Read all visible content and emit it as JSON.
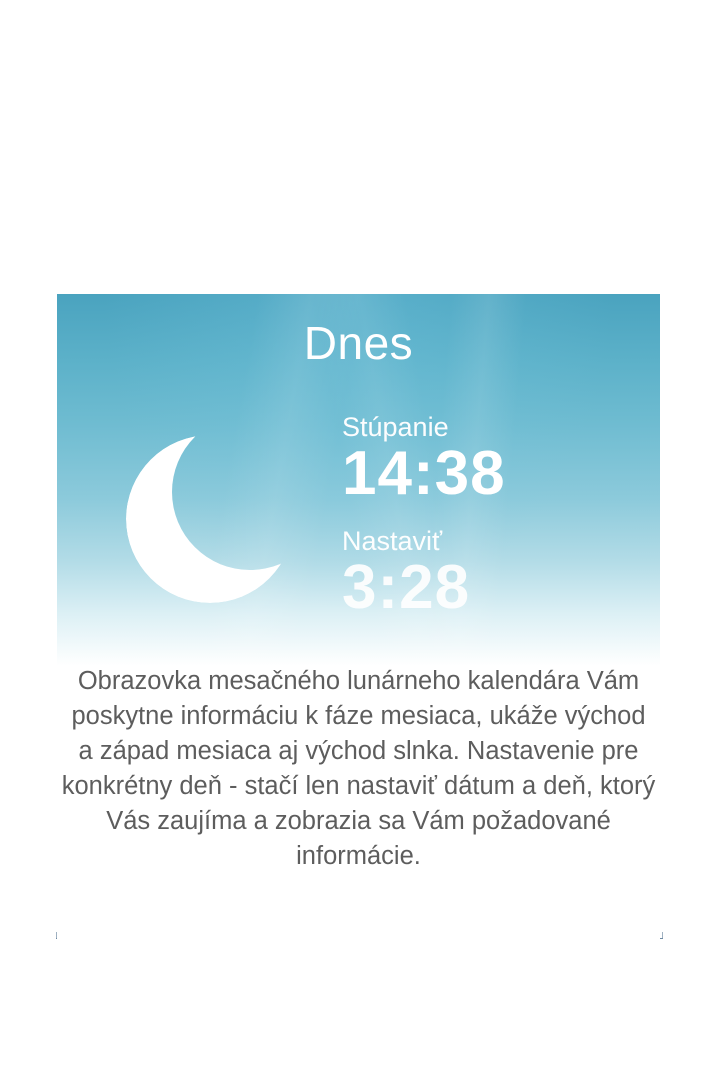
{
  "card": {
    "title": "Dnes",
    "moonrise": {
      "label": "Stúpanie",
      "time": "14:38"
    },
    "moonset": {
      "label": "Nastaviť",
      "time": "3:28"
    },
    "moon_icon": "crescent-moon-icon"
  },
  "description": "Obrazovka mesačného lunárneho kalendára Vám poskytne informáciu k fáze mesiaca, ukáže východ a západ mesiaca aj východ slnka. Nastavenie pre konkrétny deň - stačí len nastaviť dátum a deň, ktorý Vás zaujíma a zobrazia sa Vám požadované informácie.",
  "colors": {
    "sky_top": "#4aa3bf",
    "sky_bottom": "#ffffff",
    "text_white": "#ffffff",
    "description_text": "#5d5d5d"
  }
}
